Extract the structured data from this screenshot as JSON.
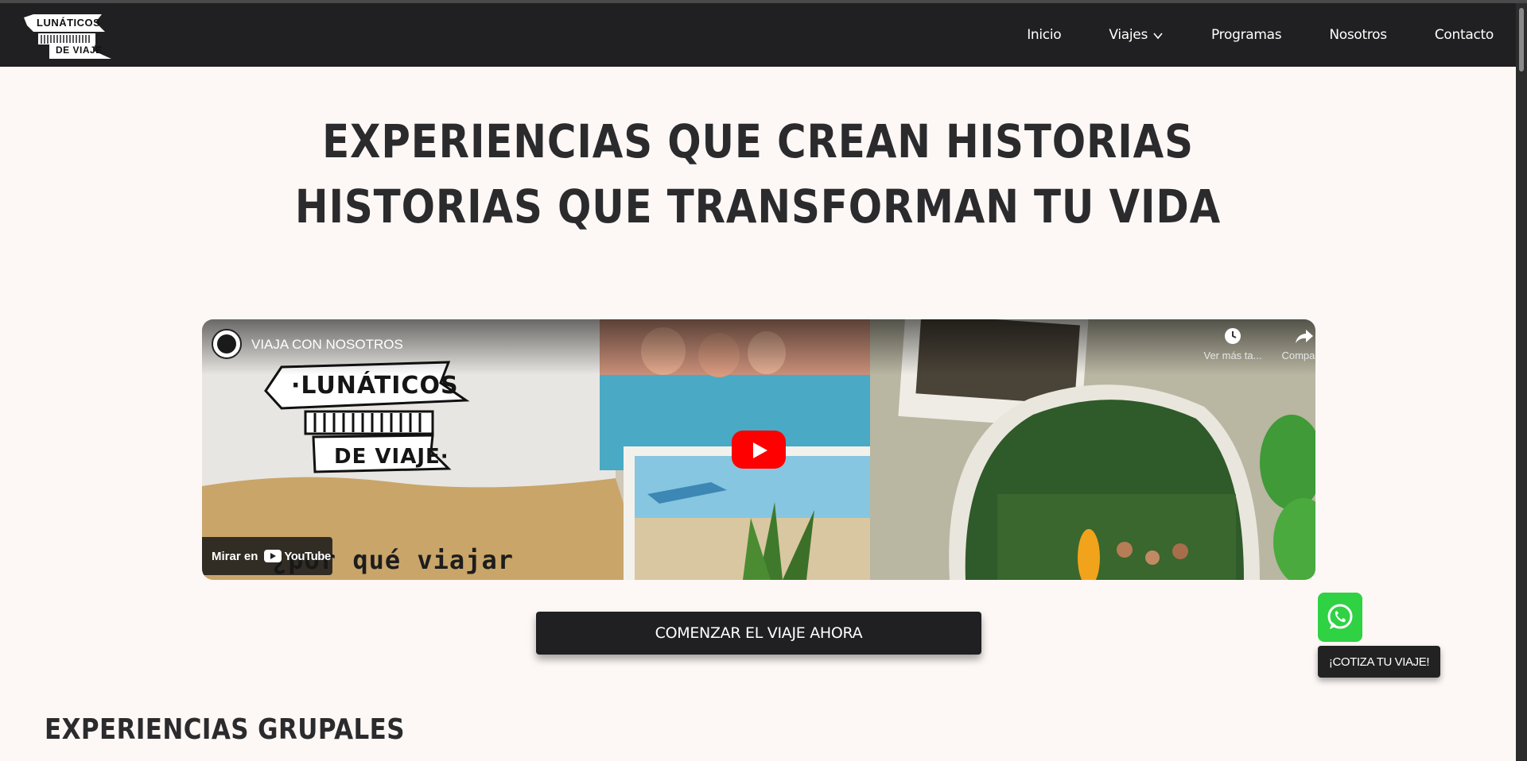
{
  "brand": {
    "logo_top": "LUNÁTICOS",
    "logo_bottom": "DE VIAJE"
  },
  "nav": {
    "items": [
      {
        "label": "Inicio"
      },
      {
        "label": "Viajes",
        "has_dropdown": true
      },
      {
        "label": "Programas"
      },
      {
        "label": "Nosotros"
      },
      {
        "label": "Contacto"
      }
    ]
  },
  "hero": {
    "line1": "EXPERIENCIAS QUE CREAN HISTORIAS",
    "line2": "HISTORIAS QUE TRANSFORMAN TU VIDA"
  },
  "video": {
    "channel_title": "VIAJA CON NOSOTROS",
    "watch_later_label": "Ver más ta...",
    "share_label": "Compartir",
    "watch_on_label": "Mirar en",
    "youtube_label": "YouTube",
    "logo_top": "·LUNÁTICOS",
    "logo_bottom": "DE VIAJE·",
    "caption": "¿por qué viajar"
  },
  "cta": {
    "label": "COMENZAR EL VIAJE AHORA"
  },
  "whatsapp": {
    "tooltip": "¡COTIZA TU VIAJE!",
    "color": "#2fd243"
  },
  "section": {
    "title": "EXPERIENCIAS GRUPALES"
  },
  "colors": {
    "page_bg": "#fdf8f6",
    "nav_bg": "#202022",
    "text_dark": "#2b2b2d",
    "youtube_red": "#ff0000"
  }
}
